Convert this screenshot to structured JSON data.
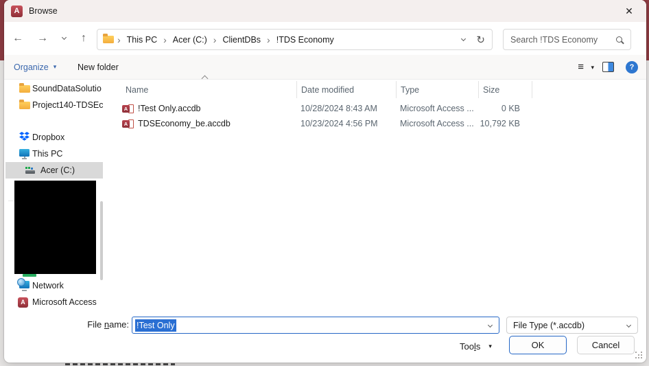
{
  "window": {
    "title": "Browse"
  },
  "icons": {
    "access_letter": "A",
    "back": "←",
    "forward": "→",
    "up": "↑",
    "refresh": "↻",
    "close": "✕",
    "menu": "≡",
    "caret_down": "▾",
    "crumb_sep": "›",
    "help": "?"
  },
  "nav": {
    "breadcrumb": [
      "This PC",
      "Acer (C:)",
      "ClientDBs",
      "!TDS Economy"
    ],
    "search_placeholder": "Search !TDS Economy"
  },
  "toolbar": {
    "organize": "Organize",
    "new_folder": "New folder"
  },
  "sidebar": {
    "items": {
      "folder1": "SoundDataSolutio",
      "folder2": "Project140-TDSEc",
      "dropbox": "Dropbox",
      "this_pc": "This PC",
      "acer_c": "Acer (C:)",
      "network": "Network",
      "ms_access": "Microsoft Access"
    },
    "selected_item": "Acer (C:)"
  },
  "filelist": {
    "columns": {
      "name": "Name",
      "date_modified": "Date modified",
      "type": "Type",
      "size": "Size"
    },
    "rows": [
      {
        "name": "!Test Only.accdb",
        "date_modified": "10/28/2024 8:43 AM",
        "type": "Microsoft Access ...",
        "size": "0 KB"
      },
      {
        "name": "TDSEconomy_be.accdb",
        "date_modified": "10/23/2024 4:56 PM",
        "type": "Microsoft Access ...",
        "size": "10,792 KB"
      }
    ]
  },
  "footer": {
    "file_name_label": [
      "File ",
      "n",
      "ame:"
    ],
    "file_name_value": "!Test Only",
    "file_type_value": "File Type (*.accdb)",
    "tools_label": [
      "Too",
      "l",
      "s"
    ],
    "ok": "OK",
    "cancel": "Cancel"
  },
  "colors": {
    "window_chrome_red": "#8d3b42",
    "titlebar_bg": "#f4efee",
    "accent_blue": "#2567c6",
    "selection_blue": "#2a6fd3",
    "access_red": "#a4373a",
    "selected_sidebar_bg": "#d9d9d9"
  }
}
